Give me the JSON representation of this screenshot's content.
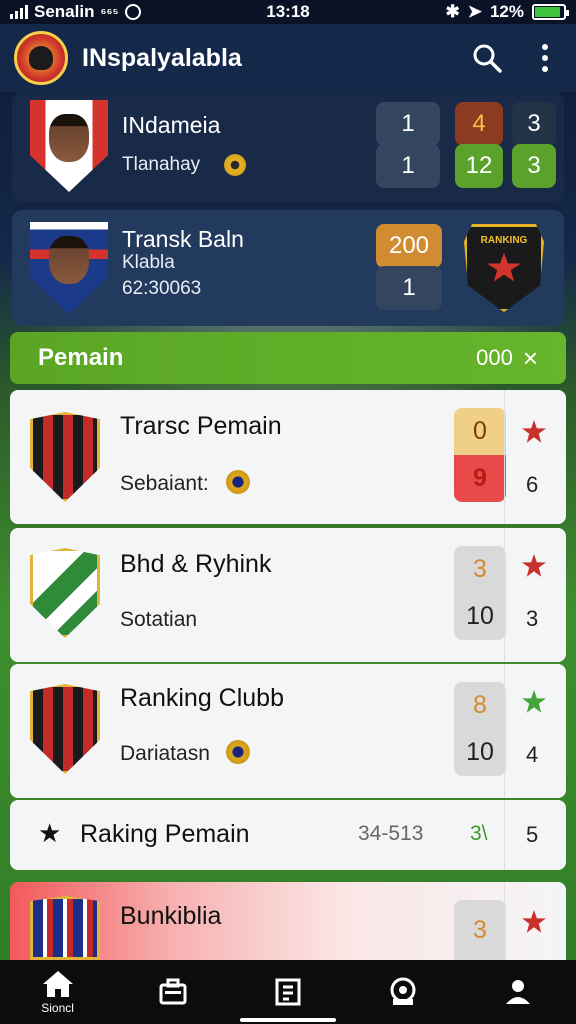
{
  "status_bar": {
    "carrier": "Senalin",
    "extra": "⁶⁶⁵",
    "time": "13:18",
    "battery": "12%",
    "battery_level": 0.9
  },
  "header": {
    "title": "INspalyalabla"
  },
  "matches": [
    {
      "name": "INdameia",
      "sub": "Tlanahay",
      "stats": [
        "1",
        "4",
        "3",
        "1",
        "12",
        "3"
      ]
    },
    {
      "name": "Transk Baln",
      "sub1": "Klabla",
      "sub2": "62:30063",
      "stats": [
        "200",
        "1"
      ],
      "emblem_text": "RANKING"
    }
  ],
  "section": {
    "title": "Pemain",
    "right": "000",
    "close": "×"
  },
  "rows": [
    {
      "title": "Trarsc Pemain",
      "sub": "Sebaiant:",
      "top": "0",
      "bottom": "9",
      "right_num": "6"
    },
    {
      "title": "Bhd & Ryhink",
      "sub": "Sotatian",
      "top": "3",
      "bottom": "10",
      "right_num": "3"
    },
    {
      "title": "Ranking Clubb",
      "sub": "Dariatasn",
      "top": "8",
      "bottom": "10",
      "right_num": "4"
    },
    {
      "title": "Raking Pemain",
      "value": "34-513",
      "mid": "3\\",
      "right_num": "5"
    },
    {
      "title": "Bunkiblia",
      "top": "3"
    }
  ],
  "nav": {
    "home_label": "Sioncl"
  },
  "colors": {
    "accent_green": "#5ba22d",
    "header_navy": "#14284a",
    "alert_red": "#e84a4a",
    "badge_orange": "#d18b30"
  }
}
